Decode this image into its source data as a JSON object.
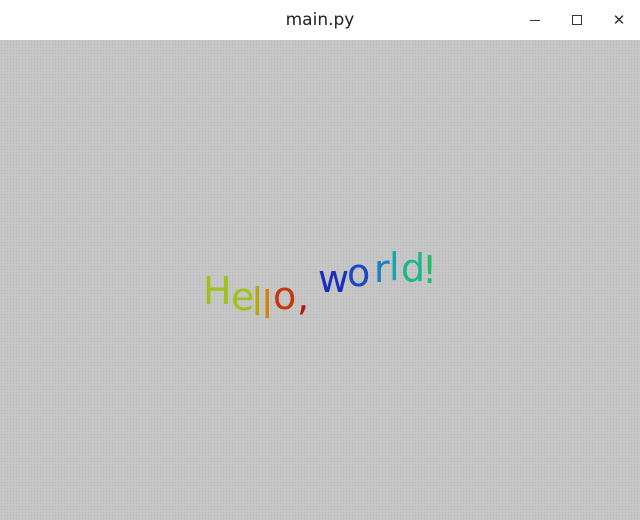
{
  "window": {
    "title": "main.py",
    "minimize_icon": "minimize-icon",
    "maximize_icon": "maximize-icon",
    "close_icon": "close-icon",
    "close_glyph": "✕"
  },
  "canvas": {
    "background": "#c6c6c6",
    "text": "Hello, world!",
    "letters": [
      {
        "char": "H",
        "color": "#9ec21a"
      },
      {
        "char": "e",
        "color": "#9ec21a"
      },
      {
        "char": "l",
        "color": "#b3a70a"
      },
      {
        "char": "l",
        "color": "#c9870c"
      },
      {
        "char": "o",
        "color": "#c6380b"
      },
      {
        "char": ",",
        "color": "#b31515"
      },
      {
        "char": " ",
        "color": "#000000"
      },
      {
        "char": "w",
        "color": "#1a2ec4"
      },
      {
        "char": "o",
        "color": "#1b48c9"
      },
      {
        "char": "r",
        "color": "#1a7fc6"
      },
      {
        "char": "l",
        "color": "#17a6ae"
      },
      {
        "char": "d",
        "color": "#19b789"
      },
      {
        "char": "!",
        "color": "#1ec06b"
      }
    ]
  }
}
